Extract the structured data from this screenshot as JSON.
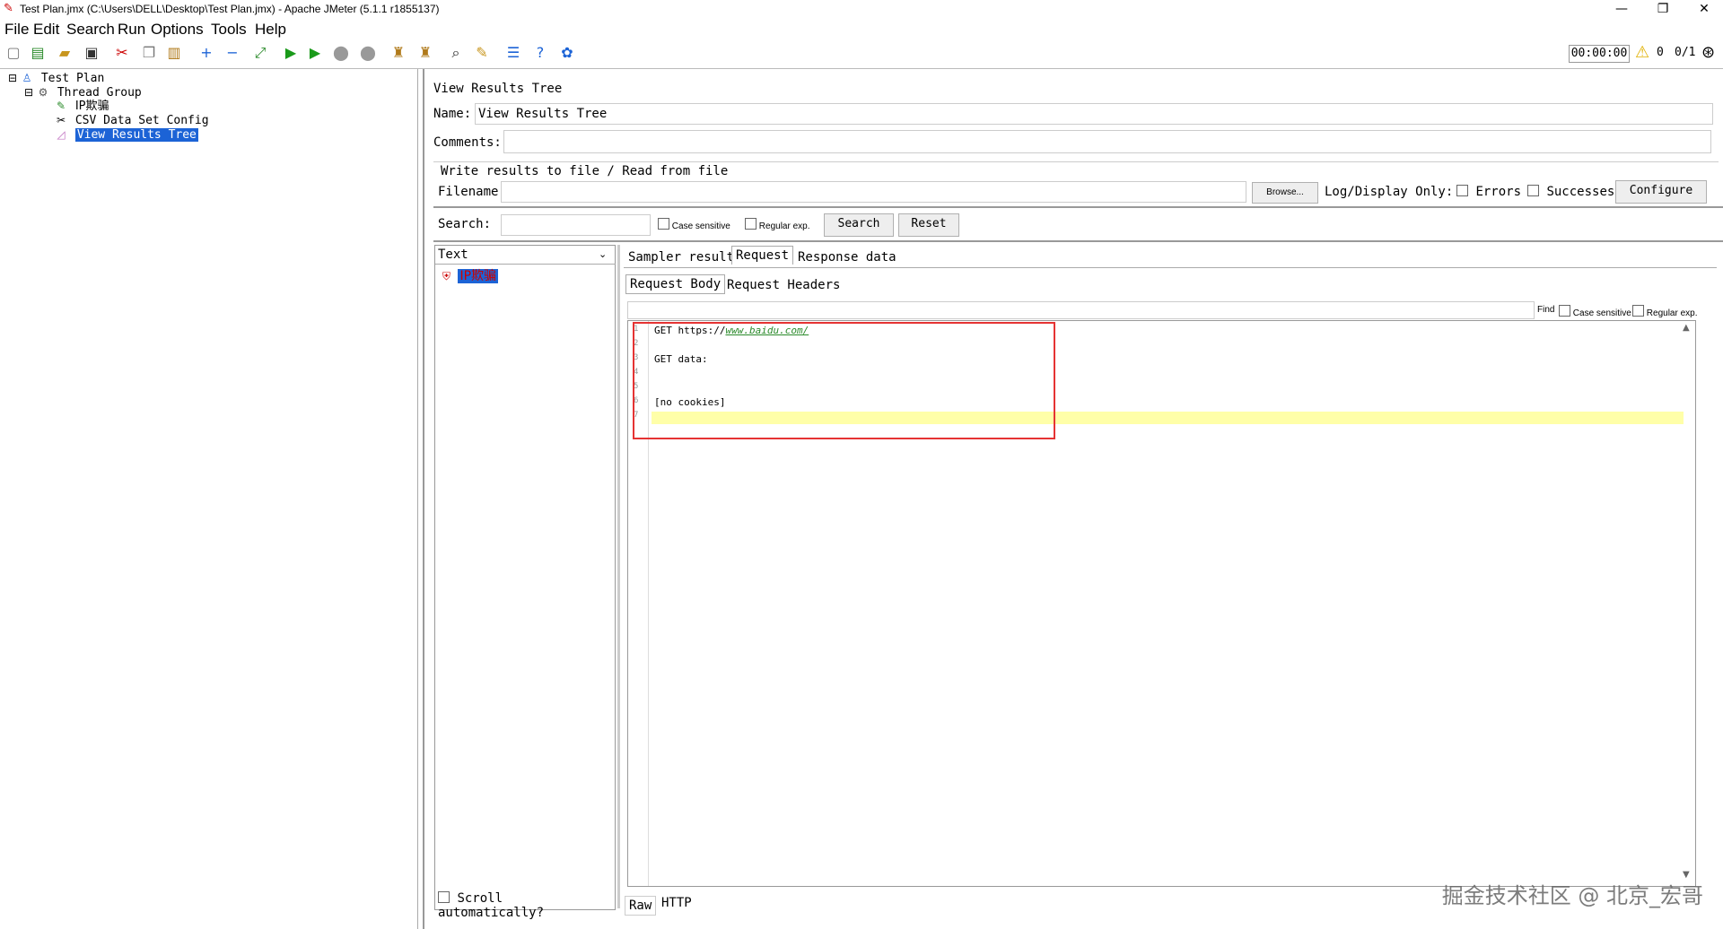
{
  "window": {
    "title": "Test Plan.jmx (C:\\Users\\DELL\\Desktop\\Test Plan.jmx) - Apache JMeter (5.1.1 r1855137)"
  },
  "menu": [
    "File",
    "Edit",
    "Search",
    "Run",
    "Options",
    "Tools",
    "Help"
  ],
  "toolbar": {
    "timer": "00:00:00",
    "warn_count": "0",
    "threads": "0/1"
  },
  "tree": {
    "test_plan": "Test Plan",
    "thread_group": "Thread Group",
    "ip_spoof": "IP欺骗",
    "csv_config": "CSV Data Set Config",
    "results_tree": "View Results Tree"
  },
  "panel": {
    "header": "View Results Tree",
    "name_label": "Name:",
    "name_value": "View Results Tree",
    "comments_label": "Comments:",
    "write_results": "Write results to file / Read from file",
    "filename_label": "Filename",
    "browse": "Browse...",
    "log_display": "Log/Display Only:",
    "errors": "Errors",
    "successes": "Successes",
    "configure": "Configure",
    "search_label": "Search:",
    "case_sensitive": "Case sensitive",
    "regular_exp": "Regular exp.",
    "search_btn": "Search",
    "reset_btn": "Reset"
  },
  "results": {
    "renderer": "Text",
    "sample": "IP欺骗",
    "scroll_auto": "Scroll automatically?"
  },
  "tabs": {
    "sampler_result": "Sampler result",
    "request": "Request",
    "response_data": "Response data",
    "request_body": "Request Body",
    "request_headers": "Request Headers",
    "find": "Find",
    "case_sensitive": "Case sensitive",
    "regular_exp": "Regular exp.",
    "raw": "Raw",
    "http": "HTTP"
  },
  "code": {
    "line_numbers": [
      "1",
      "2",
      "3",
      "4",
      "5",
      "6",
      "7"
    ],
    "get_prefix": "GET https://",
    "url": "www.baidu.com/",
    "get_data": "GET data:",
    "no_cookies": "[no cookies]"
  },
  "watermark": "掘金技术社区 @ 北京_宏哥",
  "colors": {
    "selection": "#1c63d6",
    "highlight_line": "#ffffa8",
    "annotation_box": "#e53333",
    "link": "#2a8a2a"
  }
}
